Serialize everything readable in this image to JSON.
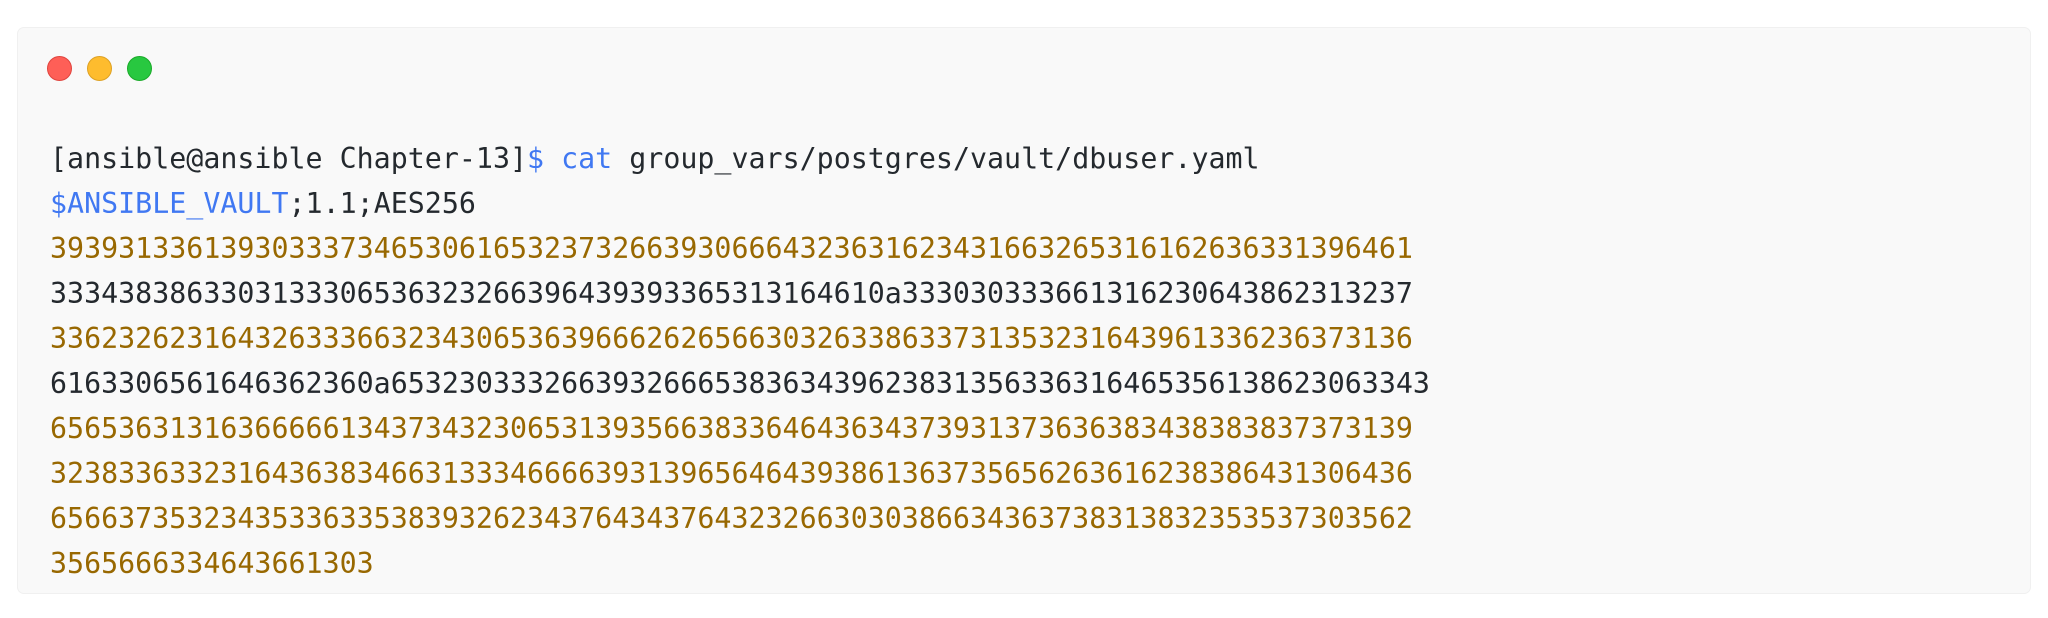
{
  "window": {
    "controls": [
      "close",
      "minimize",
      "maximize"
    ],
    "colors": {
      "close": "#fe5f57",
      "minimize": "#febc2e",
      "maximize": "#28c840",
      "background": "#f9f9f9",
      "accent_blue": "#4078f2",
      "accent_gold": "#986801",
      "text": "#24292e"
    }
  },
  "terminal": {
    "prompt": "[ansible@ansible Chapter-13]",
    "prompt_symbol": "$",
    "command": "cat",
    "argument": " group_vars/postgres/vault/dbuser.yaml",
    "vault_header_var": "$ANSIBLE_VAULT",
    "vault_header_rest": ";1.1;AES256",
    "lines": [
      "39393133613930333734653061653237326639306664323631623431663265316162636331396461",
      "3334383863303133306536323266396439393365313164610a333030333661316230643862313237",
      "33623262316432633366323430653639666262656630326338633731353231643961336236373136",
      "6163306561646362360a6532303332663932666538363439623831356336316465356138623063343",
      "65653631316366666134373432306531393566383364643634373931373636383438383837373139",
      "32383363323164363834663133346666393139656464393861363735656263616238386431306436",
      "65663735323435336335383932623437643437643232663030386634363738313832353537303562",
      "3565666334643661303"
    ]
  }
}
